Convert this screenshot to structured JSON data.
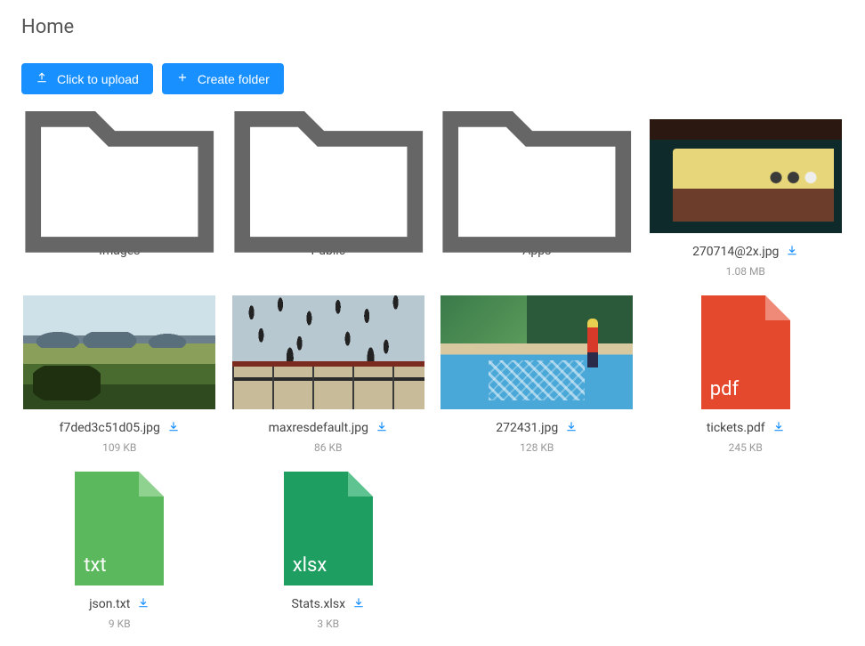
{
  "title": "Home",
  "actions": {
    "upload": "Click to upload",
    "create_folder": "Create folder"
  },
  "colors": {
    "accent": "#1890ff",
    "pdf": "#e5492d",
    "txt": "#5cb85c",
    "xlsx": "#1e9e60"
  },
  "items": [
    {
      "type": "folder",
      "name": "Images"
    },
    {
      "type": "folder",
      "name": "Public"
    },
    {
      "type": "folder",
      "name": "Apps"
    },
    {
      "type": "image",
      "name": "270714@2x.jpg",
      "size": "1.08 MB",
      "thumb": "nighthawks"
    },
    {
      "type": "image",
      "name": "f7ded3c51d05.jpg",
      "size": "109 KB",
      "thumb": "landscape"
    },
    {
      "type": "image",
      "name": "maxresdefault.jpg",
      "size": "86 KB",
      "thumb": "golconda"
    },
    {
      "type": "image",
      "name": "272431.jpg",
      "size": "128 KB",
      "thumb": "pool"
    },
    {
      "type": "file",
      "name": "tickets.pdf",
      "size": "245 KB",
      "ext": "pdf"
    },
    {
      "type": "file",
      "name": "json.txt",
      "size": "9 KB",
      "ext": "txt"
    },
    {
      "type": "file",
      "name": "Stats.xlsx",
      "size": "3 KB",
      "ext": "xlsx"
    }
  ]
}
